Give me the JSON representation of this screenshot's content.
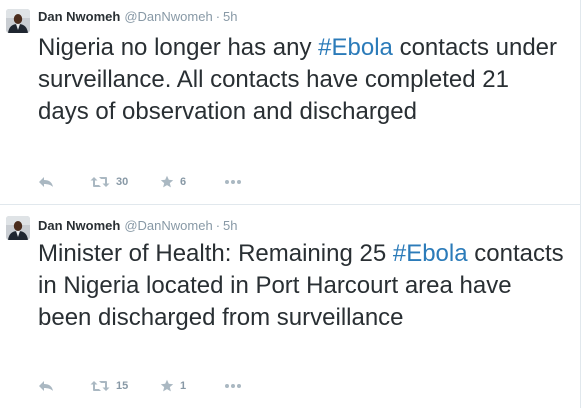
{
  "colors": {
    "text": "#292f33",
    "muted": "#8899a6",
    "hashtag": "#2b7bb9",
    "divider": "#e1e8ed"
  },
  "tweets": [
    {
      "author": {
        "fullname": "Dan Nwomeh",
        "username": "@DanNwomeh",
        "separator": "·",
        "time": "5h",
        "avatar_icon": "profile-photo"
      },
      "text_before": "Nigeria no longer has any ",
      "hashtag": "#Ebola",
      "text_after": " contacts under surveillance. All contacts have completed 21 days of observation and discharged",
      "actions": {
        "reply_icon": "reply-icon",
        "retweet_icon": "retweet-icon",
        "retweet_count": "30",
        "favorite_icon": "star-icon",
        "favorite_count": "6",
        "more_icon": "more-icon"
      }
    },
    {
      "author": {
        "fullname": "Dan Nwomeh",
        "username": "@DanNwomeh",
        "separator": "·",
        "time": "5h",
        "avatar_icon": "profile-photo"
      },
      "text_before": "Minister of Health: Remaining 25 ",
      "hashtag": "#Ebola",
      "text_after": " contacts in Nigeria located in Port Harcourt area have been discharged from surveillance",
      "actions": {
        "reply_icon": "reply-icon",
        "retweet_icon": "retweet-icon",
        "retweet_count": "15",
        "favorite_icon": "star-icon",
        "favorite_count": "1",
        "more_icon": "more-icon"
      }
    }
  ]
}
